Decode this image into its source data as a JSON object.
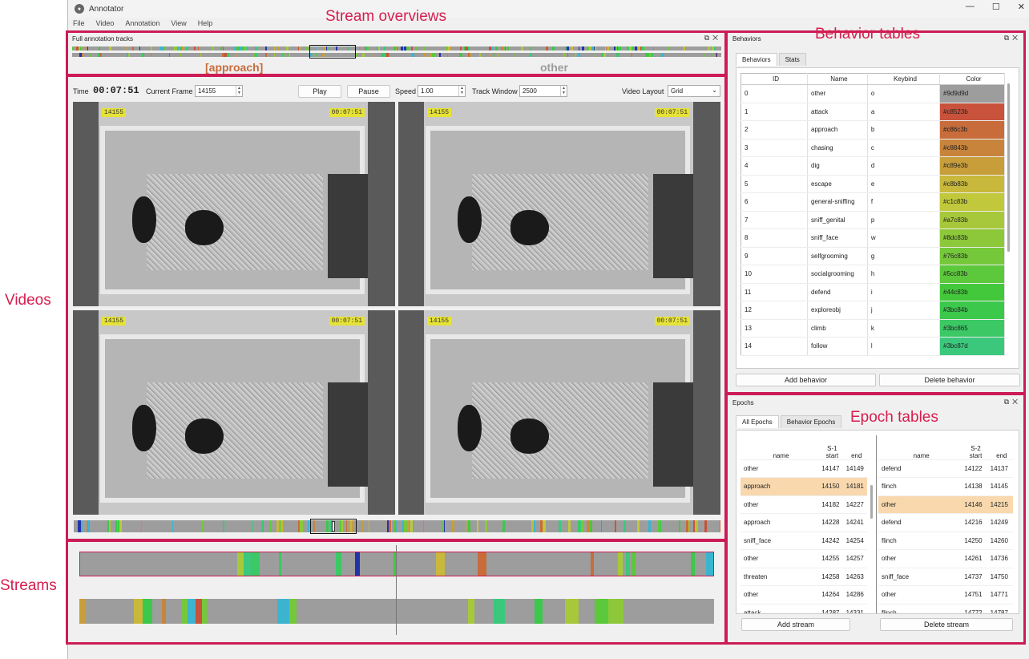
{
  "window": {
    "title": "Annotator",
    "controls": [
      "—",
      "☐",
      "✕"
    ]
  },
  "menu": [
    "File",
    "Video",
    "Annotation",
    "View",
    "Help"
  ],
  "overview": {
    "title": "Full annotation tracks",
    "label_left": "[approach]",
    "label_right": "other"
  },
  "controls": {
    "time_label": "Time",
    "time_value": "00:07:51",
    "frame_label": "Current Frame",
    "frame_value": "14155",
    "play_label": "Play",
    "pause_label": "Pause",
    "speed_label": "Speed",
    "speed_value": "1.00",
    "window_label": "Track Window",
    "window_value": "2500",
    "layout_label": "Video Layout",
    "layout_value": "Grid"
  },
  "video_tags": {
    "frame": "14155",
    "time": "00:07:51"
  },
  "behaviors_panel": {
    "title": "Behaviors",
    "tabs": [
      "Behaviors",
      "Stats"
    ],
    "headers": [
      "ID",
      "Name",
      "Keybind",
      "Color"
    ],
    "rows": [
      {
        "id": "0",
        "name": "other",
        "key": "o",
        "color": "#9d9d9d"
      },
      {
        "id": "1",
        "name": "attack",
        "key": "a",
        "color": "#c8523b"
      },
      {
        "id": "2",
        "name": "approach",
        "key": "b",
        "color": "#c86c3b"
      },
      {
        "id": "3",
        "name": "chasing",
        "key": "c",
        "color": "#c8843b"
      },
      {
        "id": "4",
        "name": "dig",
        "key": "d",
        "color": "#c89e3b"
      },
      {
        "id": "5",
        "name": "escape",
        "key": "e",
        "color": "#c8b83b"
      },
      {
        "id": "6",
        "name": "general-sniffing",
        "key": "f",
        "color": "#c1c83b"
      },
      {
        "id": "7",
        "name": "sniff_genital",
        "key": "p",
        "color": "#a7c83b"
      },
      {
        "id": "8",
        "name": "sniff_face",
        "key": "w",
        "color": "#8dc83b"
      },
      {
        "id": "9",
        "name": "selfgrooming",
        "key": "g",
        "color": "#76c83b"
      },
      {
        "id": "10",
        "name": "socialgrooming",
        "key": "h",
        "color": "#5cc83b"
      },
      {
        "id": "11",
        "name": "defend",
        "key": "i",
        "color": "#44c83b"
      },
      {
        "id": "12",
        "name": "exploreobj",
        "key": "j",
        "color": "#3bc84b"
      },
      {
        "id": "13",
        "name": "climb",
        "key": "k",
        "color": "#3bc865"
      },
      {
        "id": "14",
        "name": "follow",
        "key": "l",
        "color": "#3bc87d"
      }
    ],
    "add_label": "Add behavior",
    "delete_label": "Delete behavior"
  },
  "epochs_panel": {
    "title": "Epochs",
    "tabs": [
      "All Epochs",
      "Behavior Epochs"
    ],
    "left": {
      "stream": "S-1",
      "headers": [
        "name",
        "start",
        "end"
      ],
      "rows": [
        [
          "other",
          "14147",
          "14149"
        ],
        [
          "approach",
          "14150",
          "14181"
        ],
        [
          "other",
          "14182",
          "14227"
        ],
        [
          "approach",
          "14228",
          "14241"
        ],
        [
          "sniff_face",
          "14242",
          "14254"
        ],
        [
          "other",
          "14255",
          "14257"
        ],
        [
          "threaten",
          "14258",
          "14263"
        ],
        [
          "other",
          "14264",
          "14286"
        ],
        [
          "attack",
          "14287",
          "14331"
        ]
      ],
      "highlight": 1
    },
    "right": {
      "stream": "S-2",
      "headers": [
        "name",
        "start",
        "end"
      ],
      "rows": [
        [
          "defend",
          "14122",
          "14137"
        ],
        [
          "flinch",
          "14138",
          "14145"
        ],
        [
          "other",
          "14146",
          "14215"
        ],
        [
          "defend",
          "14216",
          "14249"
        ],
        [
          "flinch",
          "14250",
          "14260"
        ],
        [
          "other",
          "14261",
          "14736"
        ],
        [
          "sniff_face",
          "14737",
          "14750"
        ],
        [
          "other",
          "14751",
          "14771"
        ],
        [
          "flinch",
          "14772",
          "14787"
        ]
      ],
      "highlight": 2
    },
    "add_label": "Add stream",
    "delete_label": "Delete stream"
  },
  "annotations": {
    "stream_overviews": "Stream overviews",
    "behavior_tables": "Behavior tables",
    "videos": "Videos",
    "epoch_tables": "Epoch tables",
    "streams": "Streams"
  },
  "colors": {
    "accent": "#cc1c55",
    "highlight": "#f9d8ae",
    "tag": "#e6e236"
  }
}
